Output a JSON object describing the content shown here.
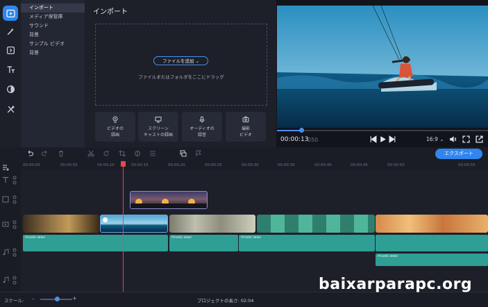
{
  "sidebar": {
    "categories": [
      "インポート",
      "メディア保管庫",
      "サウンド",
      "背景",
      "サンプル ビデオ",
      "背景"
    ],
    "rail_icons": [
      "import-icon",
      "magic-wand-icon",
      "transition-icon",
      "titles-icon",
      "filters-icon",
      "tools-icon"
    ]
  },
  "import": {
    "title": "インポート",
    "add_file": "ファイルを追加",
    "drop_hint": "ファイルまたはフォルダをここにドラッグ",
    "tiles": [
      {
        "line1": "ビデオの",
        "line2": "録画",
        "icon": "webcam-icon"
      },
      {
        "line1": "スクリーン",
        "line2": "キャストの録画",
        "icon": "screen-icon"
      },
      {
        "line1": "オーディオの",
        "line2": "録音",
        "icon": "microphone-icon"
      },
      {
        "line1": "撮影",
        "line2": "ビデオ",
        "icon": "camera-icon"
      }
    ]
  },
  "player": {
    "timecode": "00:00:13",
    "timecode_frac": "050",
    "aspect": "16:9",
    "progress": 0.12
  },
  "toolbar": {
    "export_label": "エクスポート"
  },
  "timeline": {
    "ticks": [
      "00:00:00",
      "00:00:05",
      "00:00:10",
      "00:00:15",
      "00:00:20",
      "00:00:25",
      "00:00:30",
      "00:00:35",
      "00:00:40",
      "00:00:45",
      "00:00:50",
      "00:00:55"
    ],
    "audio_labels": [
      "music.wav",
      "music.wav",
      "music.wav",
      "music.wav",
      "music.wav"
    ]
  },
  "status": {
    "scale_label": "スケール:",
    "minus": "–",
    "plus": "+",
    "project_length": "プロジェクトの長さ: 02:04",
    "scale_value": 0.5
  },
  "watermark": "baixarparapc.org",
  "colors": {
    "accent": "#2f86ee",
    "audio": "#2f9e95",
    "playhead": "#e8464a"
  }
}
